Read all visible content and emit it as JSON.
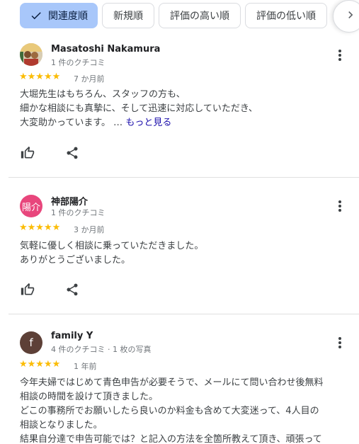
{
  "sort_chips": [
    {
      "label": "関連度順",
      "active": true
    },
    {
      "label": "新規順",
      "active": false
    },
    {
      "label": "評価の高い順",
      "active": false
    },
    {
      "label": "評価の低い順",
      "active": false
    }
  ],
  "colors": {
    "active_chip": "#a8c7fa",
    "star": "#fbbc04",
    "link": "#1a0dab",
    "avatar_review2": "#e8467c",
    "avatar_review3": "#5d4037"
  },
  "reviews": [
    {
      "author": "Masatoshi Nakamura",
      "count": "1 件のクチコミ",
      "avatar_text": "",
      "stars": "★★★★★",
      "rating": 5,
      "date": "7 か月前",
      "lines": [
        "大堀先生はもちろん、スタッフの方も、",
        "細かな相談にも真摯に、そして迅速に対応していただき、",
        "大変助かっています。 …"
      ],
      "more_label": "もっと見る"
    },
    {
      "author": "神部陽介",
      "count": "1 件のクチコミ",
      "avatar_text": "陽介",
      "stars": "★★★★★",
      "rating": 5,
      "date": "3 か月前",
      "lines": [
        "気軽に優しく相談に乗っていただきました。",
        "ありがとうございました。"
      ]
    },
    {
      "author": "family Y",
      "count": "4 件のクチコミ · 1 枚の写真",
      "avatar_text": "f",
      "stars": "★★★★★",
      "rating": 5,
      "date": "1 年前",
      "lines": [
        "今年夫婦ではじめて青色申告が必要そうで、メールにて問い合わせ後無料",
        "相談の時間を設けて頂きました。",
        "どこの事務所でお願いしたら良いのか料金も含めて大変迷って、4人目の",
        "相談となりました。",
        "結果自分達で申告可能では？と記入の方法を全箇所教えて頂き、頑張って"
      ]
    }
  ]
}
